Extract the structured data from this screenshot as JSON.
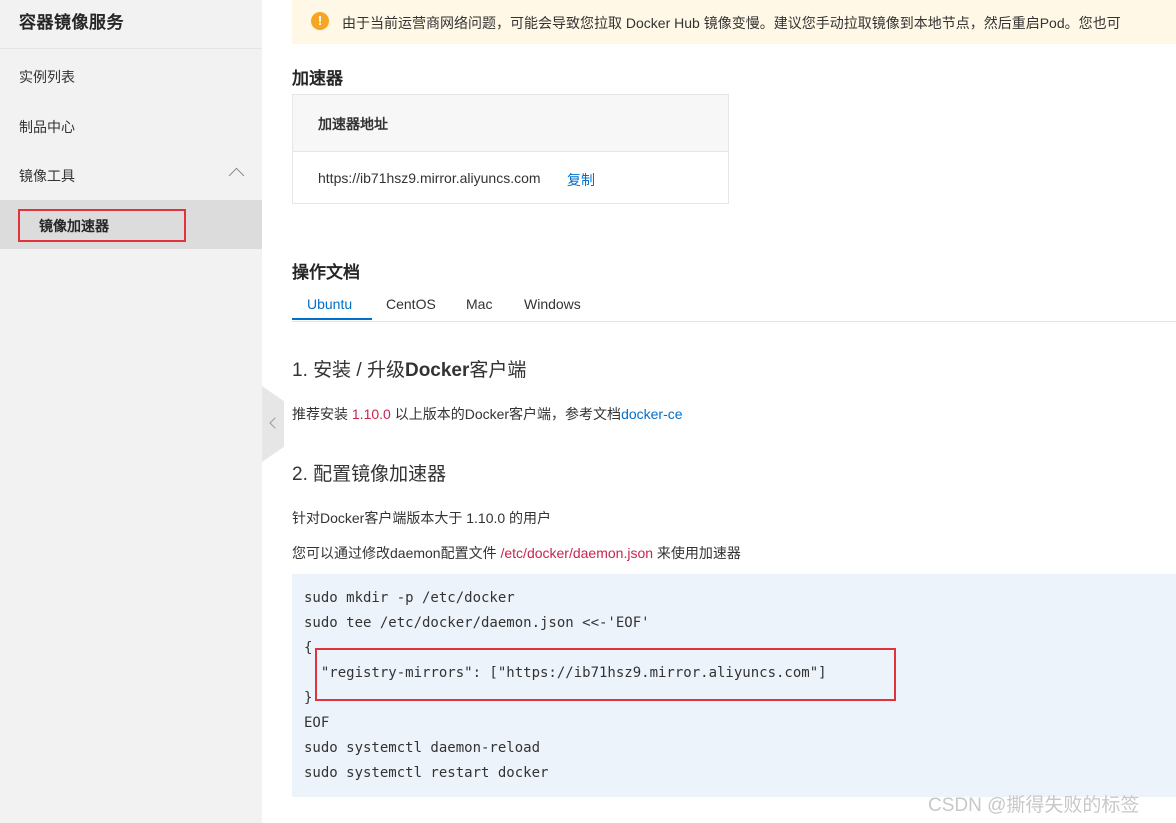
{
  "sidebar": {
    "title": "容器镜像服务",
    "items": [
      {
        "label": "实例列表"
      },
      {
        "label": "制品中心"
      },
      {
        "label": "镜像工具"
      }
    ],
    "sub_item": {
      "label": "镜像加速器"
    }
  },
  "alert": {
    "icon": "warning-icon",
    "text": "由于当前运营商网络问题，可能会导致您拉取 Docker Hub 镜像变慢。建议您手动拉取镜像到本地节点，然后重启Pod。您也可"
  },
  "accelerator": {
    "heading": "加速器",
    "header": "加速器地址",
    "url": "https://ib71hsz9.mirror.aliyuncs.com",
    "copy_label": "复制"
  },
  "docs": {
    "heading": "操作文档",
    "tabs": [
      "Ubuntu",
      "CentOS",
      "Mac",
      "Windows"
    ],
    "active_tab": "Ubuntu",
    "step1": {
      "title_prefix": "1. 安装 / 升级",
      "title_bold": "Docker",
      "title_suffix": "客户端",
      "text_before": "推荐安装 ",
      "version": "1.10.0",
      "text_after": " 以上版本的Docker客户端，参考文档",
      "link": "docker-ce"
    },
    "step2": {
      "title": "2. 配置镜像加速器",
      "line1": "针对Docker客户端版本大于 1.10.0 的用户",
      "line2_before": "您可以通过修改daemon配置文件 ",
      "line2_path": "/etc/docker/daemon.json",
      "line2_after": " 来使用加速器"
    },
    "code_lines": [
      "sudo mkdir -p /etc/docker",
      "sudo tee /etc/docker/daemon.json <<-'EOF'",
      "{",
      "  \"registry-mirrors\": [\"https://ib71hsz9.mirror.aliyuncs.com\"]",
      "}",
      "EOF",
      "sudo systemctl daemon-reload",
      "sudo systemctl restart docker"
    ]
  },
  "watermark": "CSDN @撕得失败的标签",
  "colors": {
    "accent": "#0070cc",
    "highlight_red": "#c7254e",
    "annotation_red": "#e0343c"
  }
}
